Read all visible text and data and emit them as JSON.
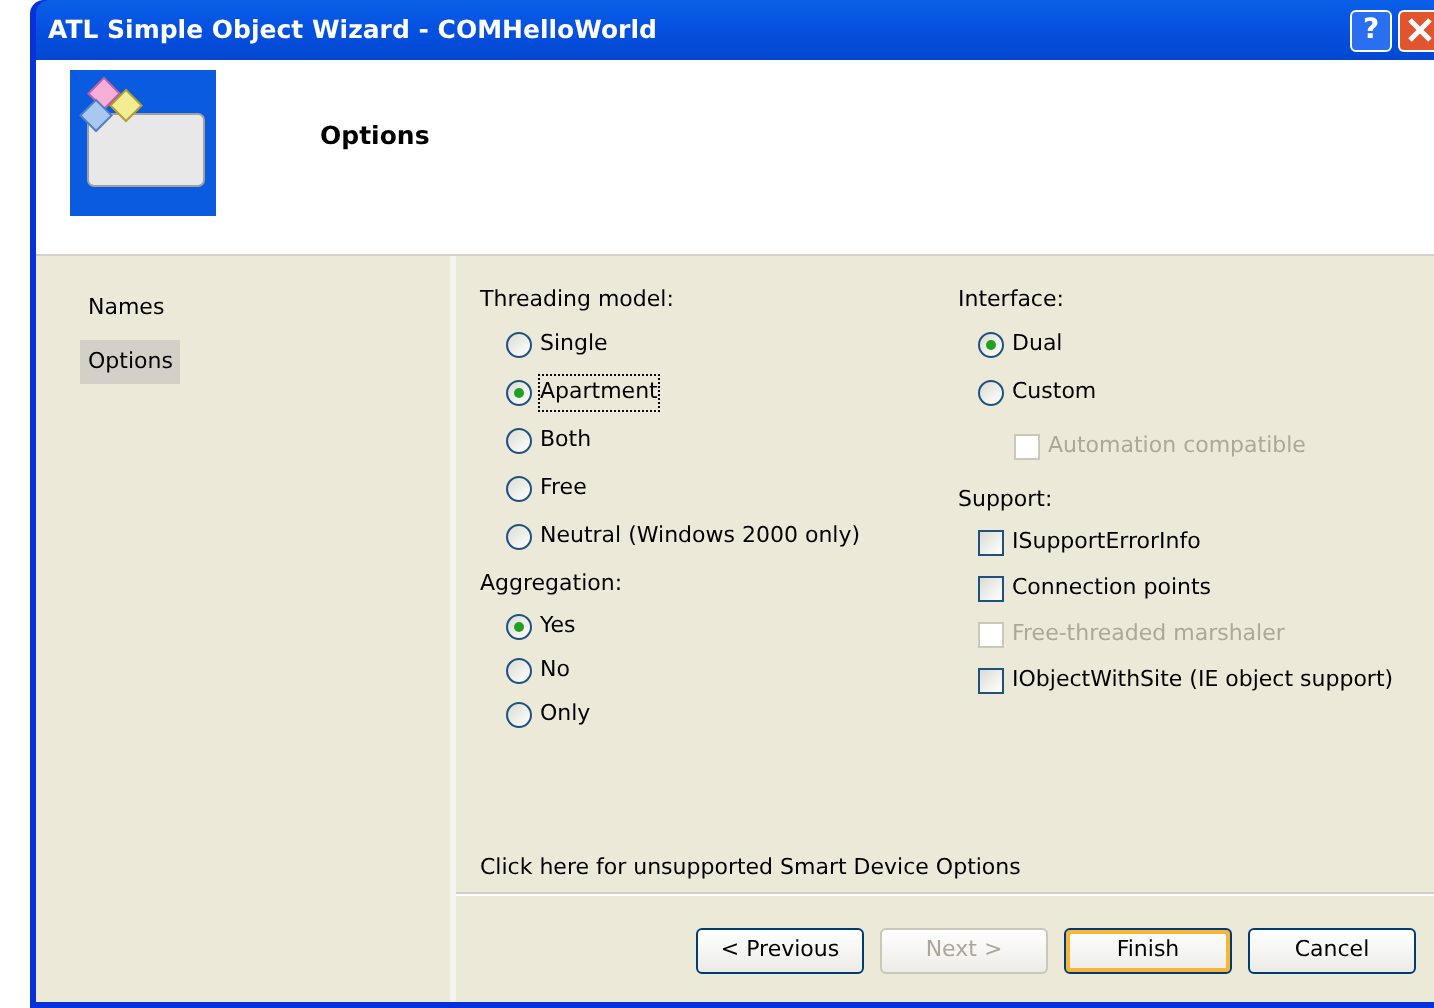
{
  "window": {
    "title": "ATL Simple Object Wizard - COMHelloWorld",
    "help": "?"
  },
  "header": {
    "title": "Options"
  },
  "sidebar": {
    "items": [
      {
        "label": "Names",
        "selected": false
      },
      {
        "label": "Options",
        "selected": true
      }
    ]
  },
  "threading": {
    "label": "Threading model:",
    "options": [
      {
        "label": "Single",
        "selected": false
      },
      {
        "label": "Apartment",
        "selected": true
      },
      {
        "label": "Both",
        "selected": false
      },
      {
        "label": "Free",
        "selected": false
      },
      {
        "label": "Neutral (Windows 2000 only)",
        "selected": false
      }
    ]
  },
  "aggregation": {
    "label": "Aggregation:",
    "options": [
      {
        "label": "Yes",
        "selected": true
      },
      {
        "label": "No",
        "selected": false
      },
      {
        "label": "Only",
        "selected": false
      }
    ]
  },
  "interface": {
    "label": "Interface:",
    "options": [
      {
        "label": "Dual",
        "selected": true
      },
      {
        "label": "Custom",
        "selected": false
      }
    ],
    "sub_option": {
      "label": "Automation compatible",
      "checked": false,
      "disabled": true
    }
  },
  "support": {
    "label": "Support:",
    "items": [
      {
        "label": "ISupportErrorInfo",
        "checked": false,
        "disabled": false
      },
      {
        "label": "Connection points",
        "checked": false,
        "disabled": false
      },
      {
        "label": "Free-threaded marshaler",
        "checked": false,
        "disabled": true
      },
      {
        "label": "IObjectWithSite (IE object support)",
        "checked": false,
        "disabled": false
      }
    ]
  },
  "link": "Click here for unsupported Smart Device Options",
  "buttons": [
    {
      "label": "< Previous",
      "disabled": false,
      "default": false
    },
    {
      "label": "Next >",
      "disabled": true,
      "default": false
    },
    {
      "label": "Finish",
      "disabled": false,
      "default": true
    },
    {
      "label": "Cancel",
      "disabled": false,
      "default": false
    }
  ]
}
